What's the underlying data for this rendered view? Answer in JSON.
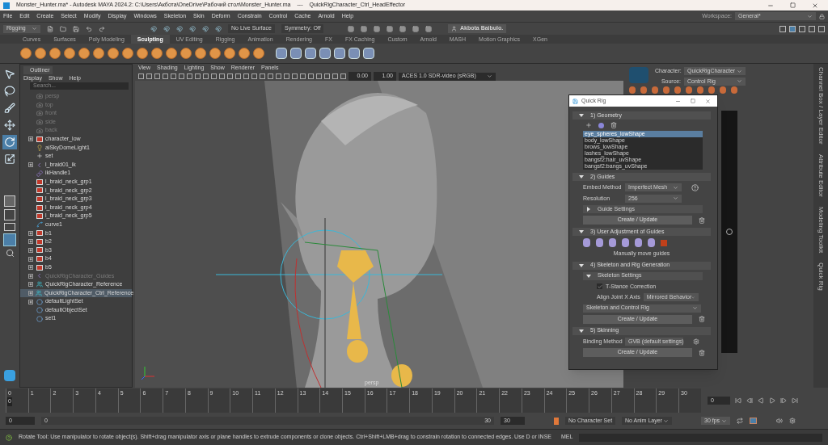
{
  "window": {
    "title": "Monster_Hunter.ma* - Autodesk MAYA 2024.2: C:\\Users\\Акбота\\OneDrive\\Рабочий стол\\Monster_Hunter.ma",
    "separator": "---",
    "context": "QuickRigCharacter_Ctrl_HeadEffector"
  },
  "menu": [
    "File",
    "Edit",
    "Create",
    "Select",
    "Modify",
    "Display",
    "Windows",
    "Skeleton",
    "Skin",
    "Deform",
    "Constrain",
    "Control",
    "Cache",
    "Arnold",
    "Help"
  ],
  "workspace": {
    "label": "Workspace:",
    "value": "General*"
  },
  "status_line": {
    "mode": "Rigging",
    "live_surface": "No Live Surface",
    "symmetry": "Symmetry: Off",
    "user": "Akbota Baibulo."
  },
  "shelf": {
    "tabs": [
      {
        "label": "Curves",
        "selected": false
      },
      {
        "label": "Surfaces",
        "selected": false
      },
      {
        "label": "Poly Modeling",
        "selected": false
      },
      {
        "label": "Sculpting",
        "selected": true
      },
      {
        "label": "UV Editing",
        "selected": false
      },
      {
        "label": "Rigging",
        "selected": false
      },
      {
        "label": "Animation",
        "selected": false
      },
      {
        "label": "Rendering",
        "selected": false
      },
      {
        "label": "FX",
        "selected": false
      },
      {
        "label": "FX Caching",
        "selected": false
      },
      {
        "label": "Custom",
        "selected": false
      },
      {
        "label": "Arnold",
        "selected": false
      },
      {
        "label": "MASH",
        "selected": false
      },
      {
        "label": "Motion Graphics",
        "selected": false
      },
      {
        "label": "XGen",
        "selected": false
      }
    ]
  },
  "toolbox": {
    "tools": [
      {
        "kind": "select",
        "selected": false
      },
      {
        "kind": "lasso",
        "selected": false
      },
      {
        "kind": "paint",
        "selected": false
      },
      {
        "kind": "move",
        "selected": false
      },
      {
        "kind": "rotate",
        "selected": true
      },
      {
        "kind": "scale",
        "selected": false
      }
    ]
  },
  "outliner": {
    "title": "Outliner",
    "menu": [
      "Display",
      "Show",
      "Help"
    ],
    "search": {
      "placeholder": "Search..."
    },
    "items": [
      {
        "label": "persp",
        "kind": "camera",
        "dimmed": true,
        "expandable": false,
        "selected": false
      },
      {
        "label": "top",
        "kind": "camera",
        "dimmed": true,
        "expandable": false,
        "selected": false
      },
      {
        "label": "front",
        "kind": "camera",
        "dimmed": true,
        "expandable": false,
        "selected": false
      },
      {
        "label": "side",
        "kind": "camera",
        "dimmed": true,
        "expandable": false,
        "selected": false
      },
      {
        "label": "back",
        "kind": "camera",
        "dimmed": true,
        "expandable": false,
        "selected": false
      },
      {
        "label": "character_low",
        "kind": "group",
        "dimmed": false,
        "expandable": true,
        "selected": false
      },
      {
        "label": "aiSkyDomeLight1",
        "kind": "light",
        "dimmed": false,
        "expandable": false,
        "selected": false
      },
      {
        "label": "set",
        "kind": "locator",
        "dimmed": false,
        "expandable": false,
        "selected": false
      },
      {
        "label": "l_braid01_ik",
        "kind": "joint",
        "dimmed": false,
        "expandable": true,
        "selected": false
      },
      {
        "label": "ikHandle1",
        "kind": "ik",
        "dimmed": false,
        "expandable": false,
        "selected": false
      },
      {
        "label": "l_braid_neck_grp1",
        "kind": "group",
        "dimmed": false,
        "expandable": false,
        "selected": false
      },
      {
        "label": "l_braid_neck_grp2",
        "kind": "group",
        "dimmed": false,
        "expandable": false,
        "selected": false
      },
      {
        "label": "l_braid_neck_grp3",
        "kind": "group",
        "dimmed": false,
        "expandable": false,
        "selected": false
      },
      {
        "label": "l_braid_neck_grp4",
        "kind": "group",
        "dimmed": false,
        "expandable": false,
        "selected": false
      },
      {
        "label": "l_braid_neck_grp5",
        "kind": "group",
        "dimmed": false,
        "expandable": false,
        "selected": false
      },
      {
        "label": "curve1",
        "kind": "curve",
        "dimmed": false,
        "expandable": false,
        "selected": false
      },
      {
        "label": "b1",
        "kind": "group",
        "dimmed": false,
        "expandable": true,
        "selected": false
      },
      {
        "label": "b2",
        "kind": "group",
        "dimmed": false,
        "expandable": true,
        "selected": false
      },
      {
        "label": "b3",
        "kind": "group",
        "dimmed": false,
        "expandable": true,
        "selected": false
      },
      {
        "label": "b4",
        "kind": "group",
        "dimmed": false,
        "expandable": true,
        "selected": false
      },
      {
        "label": "b5",
        "kind": "group",
        "dimmed": false,
        "expandable": true,
        "selected": false
      },
      {
        "label": "QuickRigCharacter_Guides",
        "kind": "joint",
        "dimmed": true,
        "expandable": true,
        "selected": false
      },
      {
        "label": "QuickRigCharacter_Reference",
        "kind": "hik",
        "dimmed": false,
        "expandable": true,
        "selected": false
      },
      {
        "label": "QuickRigCharacter_Ctrl_Reference",
        "kind": "hik",
        "dimmed": false,
        "expandable": true,
        "selected": true
      },
      {
        "label": "defaultLightSet",
        "kind": "set",
        "dimmed": false,
        "expandable": true,
        "selected": false
      },
      {
        "label": "defaultObjectSet",
        "kind": "set",
        "dimmed": false,
        "expandable": false,
        "selected": false
      },
      {
        "label": "set1",
        "kind": "set",
        "dimmed": false,
        "expandable": false,
        "selected": false
      }
    ]
  },
  "viewport": {
    "menu": [
      "View",
      "Shading",
      "Lighting",
      "Show",
      "Renderer",
      "Panels"
    ],
    "exposure": "0.00",
    "gamma": "1.00",
    "color_space": "ACES 1.0 SDR-video (sRGB)",
    "camera_label": "persp"
  },
  "hik": {
    "character_label": "Character:",
    "character": "QuickRigCharacter",
    "source_label": "Source:",
    "source": "Control Rig"
  },
  "side_tabs": [
    "Channel Box / Layer Editor",
    "Attribute Editor",
    "Modeling Toolkit",
    "Quick Rig"
  ],
  "quick_rig": {
    "title": "Quick Rig",
    "geometry": {
      "header": "1) Geometry",
      "expanded": true,
      "items": [
        {
          "label": "eye_spheres_lowShape",
          "selected": true
        },
        {
          "label": "body_lowShape",
          "selected": false
        },
        {
          "label": "brows_lowShape",
          "selected": false
        },
        {
          "label": "lashes_lowShape",
          "selected": false
        },
        {
          "label": "bangsf2:hair_uvShape",
          "selected": false
        },
        {
          "label": "bangsf2:bangs_uvShape",
          "selected": false
        }
      ]
    },
    "guides": {
      "header": "2) Guides",
      "expanded": true,
      "embed_label": "Embed Method",
      "embed": "Imperfect Mesh",
      "resolution_label": "Resolution",
      "resolution": "256",
      "settings": {
        "label": "Guide Settings",
        "expanded": false
      },
      "button": "Create / Update"
    },
    "adjust": {
      "header": "3) User Adjustment of Guides",
      "expanded": true,
      "caption": "Manually move guides"
    },
    "skeleton": {
      "header": "4) Skeleton and Rig Generation",
      "expanded": true,
      "settings": {
        "label": "Skeleton Settings",
        "expanded": true
      },
      "tstance": {
        "label": "T-Stance Correction",
        "checked": true
      },
      "align_label": "Align Joint X Axis",
      "align": "Mirrored Behavior",
      "rig_type": "Skeleton and Control Rig",
      "button": "Create / Update"
    },
    "skinning": {
      "header": "5) Skinning",
      "expanded": true,
      "binding_label": "Binding Method",
      "binding": "GVB (default settings)",
      "button": "Create / Update"
    }
  },
  "timeline": {
    "ticks": [
      "0",
      "1",
      "2",
      "3",
      "4",
      "5",
      "6",
      "7",
      "8",
      "9",
      "10",
      "11",
      "12",
      "13",
      "14",
      "15",
      "16",
      "17",
      "18",
      "19",
      "20",
      "21",
      "22",
      "23",
      "24",
      "25",
      "26",
      "27",
      "28",
      "29",
      "30"
    ],
    "current_frame": "0",
    "frame_field": "0",
    "level": 0
  },
  "range": {
    "start": "0",
    "inner_start": "0",
    "inner_end": "30",
    "end": "30",
    "character_set": "No Character Set",
    "anim_layer": "No Anim Layer",
    "fps": "30 fps",
    "level": 1
  },
  "help_line": {
    "text": "Rotate Tool: Use manipulator to rotate object(s). Shift+drag manipulator axis or plane handles to extrude components or clone objects. Ctrl+Shift+LMB+drag to constrain rotation to connected edges. Use D or INSE",
    "command_lang": "MEL"
  }
}
